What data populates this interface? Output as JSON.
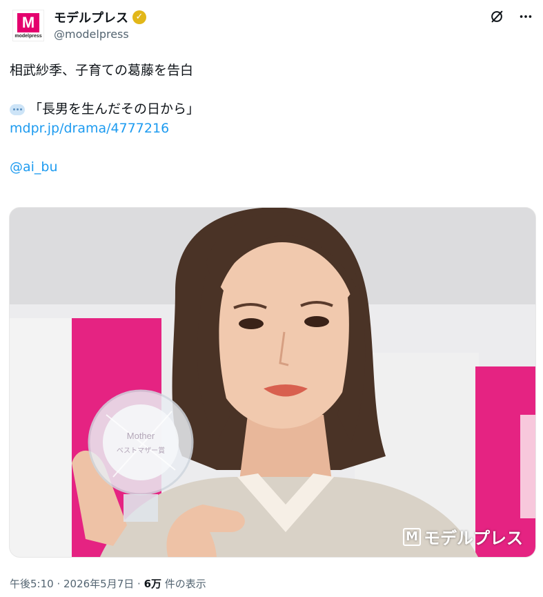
{
  "account": {
    "avatar_main": "M",
    "avatar_sub": "modelpress",
    "name": "モデルプレス",
    "handle": "@modelpress",
    "verified_color": "#e2b719"
  },
  "header_actions": {
    "grok_icon": "grok-icon",
    "more_icon": "more-icon",
    "more_label": "···"
  },
  "tweet": {
    "line1": "相武紗季、子育ての葛藤を告白",
    "quote": "「長男を生んだその日から」",
    "link": "mdpr.jp/drama/4777216",
    "mention": "@ai_bu"
  },
  "media": {
    "alt_icon": "person-photo",
    "watermark": "モデルプレス",
    "trophy_text": "Mother",
    "trophy_sub": "ベストマザー賞",
    "colors": {
      "pink": "#e4006e",
      "hair": "#4a3326"
    }
  },
  "footer": {
    "time": "午後5:10",
    "sep": " · ",
    "date": "2026年5月7日",
    "views_num": "6万",
    "views_suffix": " 件の表示"
  }
}
